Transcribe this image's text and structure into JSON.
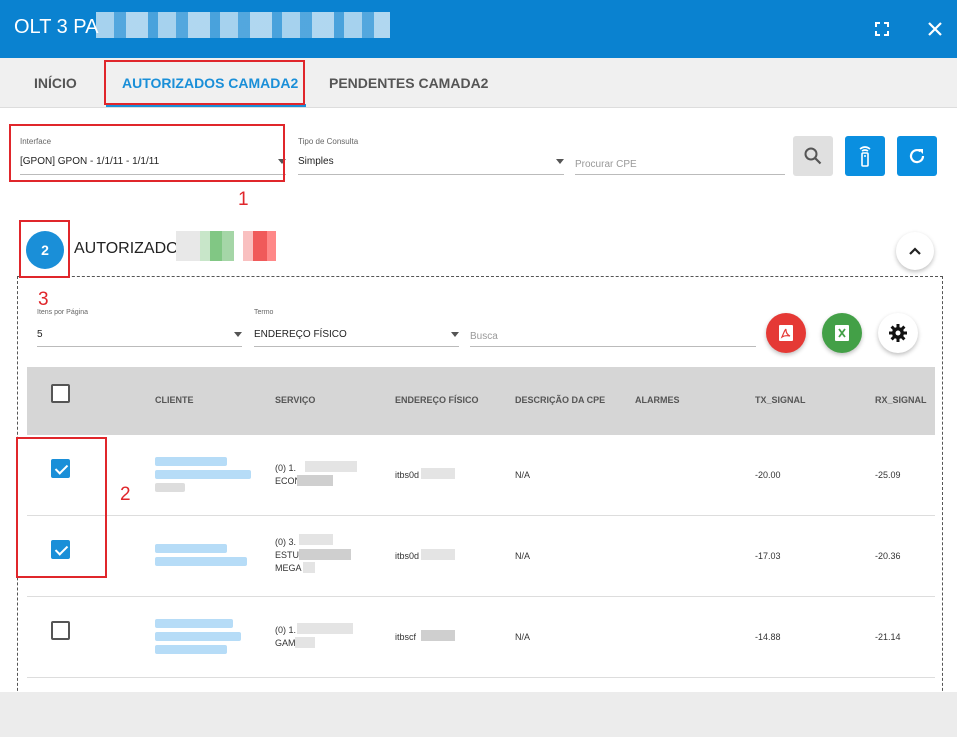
{
  "window": {
    "title": "OLT 3 PA"
  },
  "tabs": [
    {
      "label": "INÍCIO"
    },
    {
      "label": "AUTORIZADOS CAMADA2"
    },
    {
      "label": "PENDENTES CAMADA2"
    }
  ],
  "filters": {
    "interface_label": "Interface",
    "interface_value": "[GPON] GPON - 1/1/11 - 1/1/11",
    "tipo_label": "Tipo de Consulta",
    "tipo_value": "Simples",
    "procurar_placeholder": "Procurar CPE"
  },
  "section": {
    "count": "2",
    "title": "AUTORIZADOS:"
  },
  "table_controls": {
    "per_page_label": "Itens por Página",
    "per_page_value": "5",
    "termo_label": "Termo",
    "termo_value": "ENDEREÇO FÍSICO",
    "busca_placeholder": "Busca"
  },
  "table": {
    "headers": [
      "CLIENTE",
      "SERVIÇO",
      "ENDEREÇO FÍSICO",
      "DESCRIÇÃO DA CPE",
      "ALARMES",
      "TX_SIGNAL",
      "RX_SIGNAL"
    ],
    "rows": [
      {
        "checked": true,
        "servico_l1": "(0) 1.",
        "servico_l2": "ECON",
        "servico_l3": "",
        "endereco": "itbs0d",
        "descricao": "N/A",
        "tx": "-20.00",
        "rx": "-25.09"
      },
      {
        "checked": true,
        "servico_l1": "(0) 3.",
        "servico_l2": "ESTU",
        "servico_l3": "MEGA",
        "endereco": "itbs0d",
        "descricao": "N/A",
        "tx": "-17.03",
        "rx": "-20.36"
      },
      {
        "checked": false,
        "servico_l1": "(0) 1.",
        "servico_l2": "GAM",
        "servico_l3": "",
        "endereco": "itbscf",
        "descricao": "N/A",
        "tx": "-14.88",
        "rx": "-21.14"
      }
    ]
  },
  "annotations": [
    "1",
    "2",
    "3"
  ],
  "colors": {
    "primary": "#0a82d0",
    "accent": "#1a8fd8",
    "annotation": "#e0262b",
    "pdf": "#e53935",
    "excel": "#43a047"
  },
  "icons": [
    "expand-icon",
    "close-icon",
    "search-icon",
    "remote-icon",
    "refresh-icon",
    "chevron-up-icon",
    "pdf-icon",
    "excel-icon",
    "gear-icon"
  ]
}
